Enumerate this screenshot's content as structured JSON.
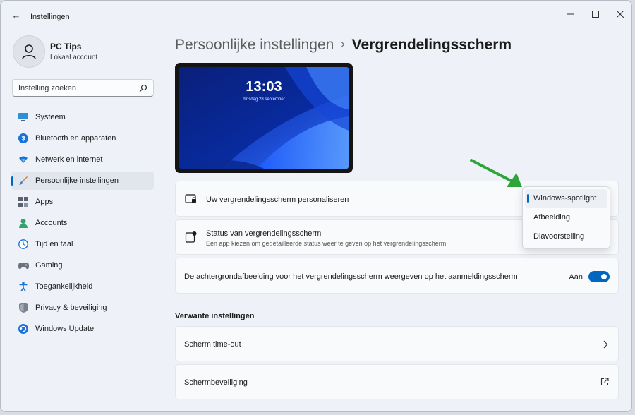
{
  "window": {
    "title": "Instellingen",
    "back_symbol": "←",
    "controls": [
      "minimize-icon",
      "maximize-icon",
      "close-icon"
    ]
  },
  "profile": {
    "name": "PC Tips",
    "account_type": "Lokaal account",
    "icon": "user-icon"
  },
  "search": {
    "placeholder": "Instelling zoeken",
    "icon": "search-icon"
  },
  "sidebar": {
    "items": [
      {
        "label": "Systeem",
        "icon": "monitor-icon",
        "active": false
      },
      {
        "label": "Bluetooth en apparaten",
        "icon": "bluetooth-icon",
        "active": false
      },
      {
        "label": "Netwerk en internet",
        "icon": "wifi-icon",
        "active": false
      },
      {
        "label": "Persoonlijke instellingen",
        "icon": "brush-icon",
        "active": true
      },
      {
        "label": "Apps",
        "icon": "apps-icon",
        "active": false
      },
      {
        "label": "Accounts",
        "icon": "account-icon",
        "active": false
      },
      {
        "label": "Tijd en taal",
        "icon": "globe-clock-icon",
        "active": false
      },
      {
        "label": "Gaming",
        "icon": "gamepad-icon",
        "active": false
      },
      {
        "label": "Toegankelijkheid",
        "icon": "accessibility-icon",
        "active": false
      },
      {
        "label": "Privacy & beveiliging",
        "icon": "shield-icon",
        "active": false
      },
      {
        "label": "Windows Update",
        "icon": "update-icon",
        "active": false
      }
    ]
  },
  "breadcrumb": {
    "parent": "Persoonlijke instellingen",
    "separator": "›",
    "current": "Vergrendelingsscherm"
  },
  "preview": {
    "time": "13:03",
    "date": "dinsdag 28 september"
  },
  "settings": {
    "personalize": {
      "title": "Uw vergrendelingsscherm personaliseren",
      "icon": "lockscreen-icon"
    },
    "status": {
      "title": "Status van vergrendelingsscherm",
      "description": "Een app kiezen om gedetailleerde status weer te geven op het vergrendelingsscherm",
      "icon": "status-app-icon"
    },
    "background_on_signin": {
      "title": "De achtergrondafbeelding voor het vergrendelingsscherm weergeven op het aanmeldingsscherm",
      "toggle_label": "Aan",
      "toggle_on": true
    }
  },
  "dropdown": {
    "options": [
      "Windows-spotlight",
      "Afbeelding",
      "Diavoorstelling"
    ],
    "selected_index": 0
  },
  "related": {
    "heading": "Verwante instellingen",
    "items": [
      {
        "label": "Scherm time-out",
        "icon": "chevron-right-icon"
      },
      {
        "label": "Schermbeveiliging",
        "icon": "external-link-icon"
      }
    ]
  },
  "colors": {
    "accent": "#0067c0",
    "annotation_arrow": "#2ea43a"
  }
}
